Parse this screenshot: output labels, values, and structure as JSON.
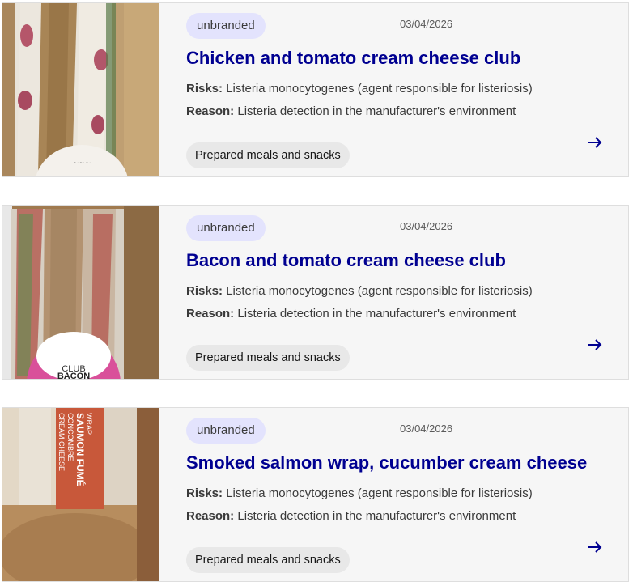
{
  "colors": {
    "title": "#000091",
    "badge_bg": "#e3e3fd",
    "card_bg": "#f6f6f6",
    "tag_bg": "#e8e8e8"
  },
  "recalls": [
    {
      "badge": "unbranded",
      "date": "03/04/2026",
      "title": "Chicken and tomato cream cheese club",
      "risks_label": "Risks:",
      "risks": "Listeria monocytogenes (agent responsible for listeriosis)",
      "reason_label": "Reason:",
      "reason": "Listeria detection in the manufacturer's environment",
      "category": "Prepared meals and snacks",
      "image": "chicken-sandwich-photo",
      "arrow_icon": "arrow-right-icon"
    },
    {
      "badge": "unbranded",
      "date": "03/04/2026",
      "title": "Bacon and tomato cream cheese club",
      "risks_label": "Risks:",
      "risks": "Listeria monocytogenes (agent responsible for listeriosis)",
      "reason_label": "Reason:",
      "reason": "Listeria detection in the manufacturer's environment",
      "category": "Prepared meals and snacks",
      "image": "bacon-sandwich-photo",
      "image_text": [
        "CLUB",
        "BACON"
      ],
      "arrow_icon": "arrow-right-icon"
    },
    {
      "badge": "unbranded",
      "date": "03/04/2026",
      "title": "Smoked salmon wrap, cucumber cream cheese",
      "risks_label": "Risks:",
      "risks": "Listeria monocytogenes (agent responsible for listeriosis)",
      "reason_label": "Reason:",
      "reason": "Listeria detection in the manufacturer's environment",
      "category": "Prepared meals and snacks",
      "image": "salmon-wrap-photo",
      "image_text": [
        "WRAP",
        "SAUMON FUMÉ",
        "CONCOMBRE",
        "CREAM CHEESE"
      ],
      "arrow_icon": "arrow-right-icon"
    }
  ]
}
